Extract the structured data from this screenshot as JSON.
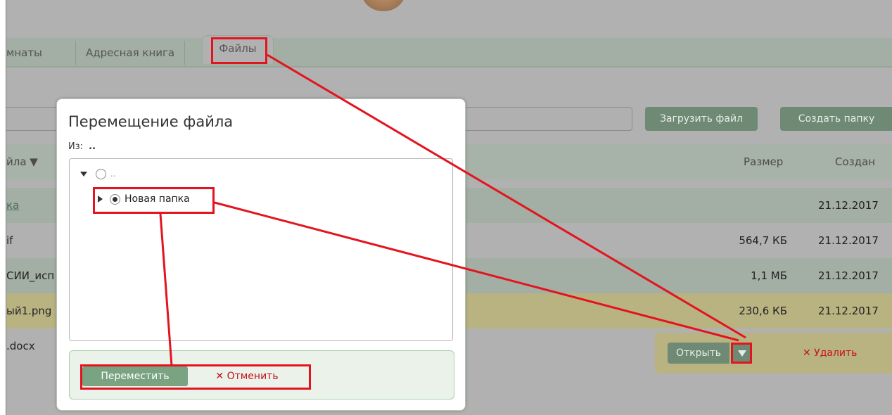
{
  "tabs": {
    "rooms": "мнаты",
    "address_book": "Адресная книга",
    "files": "Файлы"
  },
  "toolbar": {
    "upload_label": "Загрузить файл",
    "new_folder_label": "Создать папку"
  },
  "table": {
    "headers": {
      "name": "йла ▼",
      "size": "Размер",
      "created": "Создан"
    },
    "rows": [
      {
        "name": "ка",
        "size": "",
        "created": "21.12.2017"
      },
      {
        "name": "if",
        "size": "564,7 КБ",
        "created": "21.12.2017"
      },
      {
        "name": "СИИ_исп",
        "size": "1,1 МБ",
        "created": "21.12.2017"
      },
      {
        "name": "ый1.png",
        "size": "230,6 КБ",
        "created": "21.12.2017"
      },
      {
        "name": ".docx",
        "size": "",
        "created": ""
      }
    ]
  },
  "row_actions": {
    "open_label": "Открыть",
    "delete_label": "✕ Удалить"
  },
  "modal": {
    "title": "Перемещение файла",
    "from_label": "Из:",
    "from_value": "..",
    "tree": {
      "root_label": "..",
      "child_label": "Новая папка"
    },
    "move_label": "Переместить",
    "cancel_label": "✕ Отменить"
  },
  "colors": {
    "accent_green": "#6e8a74",
    "highlight_red": "#e3141e",
    "selected_row": "#b9b382",
    "delete_red": "#c4121a"
  }
}
